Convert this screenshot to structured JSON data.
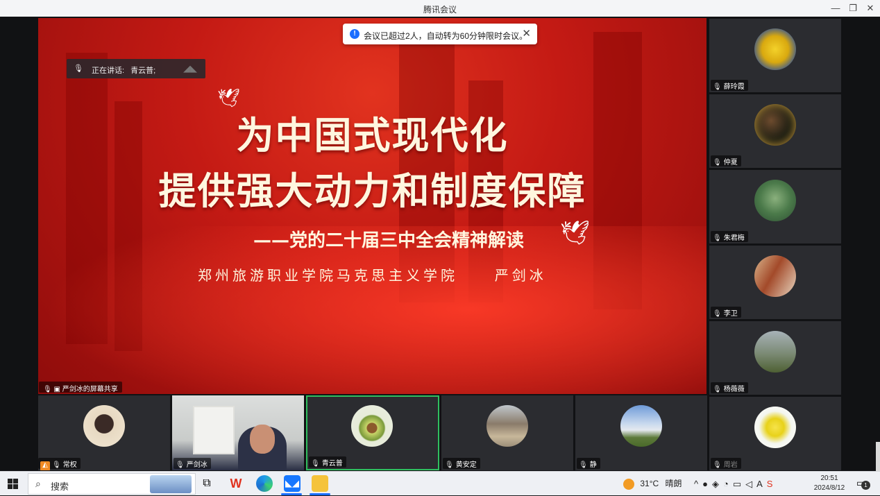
{
  "window": {
    "title": "腾讯会议"
  },
  "toast": {
    "message": "会议已超过2人，自动转为60分钟限时会议。",
    "close_icon": "close-icon",
    "info_icon": "info-icon"
  },
  "speaking": {
    "label": "正在讲话:",
    "speaker": "青云普;"
  },
  "slide": {
    "title_line1": "为中国式现代化",
    "title_line2": "提供强大动力和制度保障",
    "subtitle": "——党的二十届三中全会精神解读",
    "author_org": "郑州旅游职业学院马克思主义学院",
    "author_name": "严剑冰"
  },
  "screen_share_label": "严剑冰的屏幕共享",
  "side_participants": [
    {
      "name": "薛玲霞",
      "avatar": "yellow-flower"
    },
    {
      "name": "仲夏",
      "avatar": "lights"
    },
    {
      "name": "朱君梅",
      "avatar": "lotus-leaves"
    },
    {
      "name": "李卫",
      "avatar": "street-photo"
    },
    {
      "name": "杨薇薇",
      "avatar": "mountain-person"
    },
    {
      "name": "周岩",
      "avatar": "yellow-lily"
    }
  ],
  "bottom_participants": [
    {
      "name": "常权",
      "avatar": "cartoon-woman"
    },
    {
      "name": "严剑冰",
      "avatar": "camera-video"
    },
    {
      "name": "青云普",
      "avatar": "avocado"
    },
    {
      "name": "黄安定",
      "avatar": "building"
    },
    {
      "name": "静",
      "avatar": "sky-field"
    }
  ],
  "taskbar": {
    "search_label": "搜索",
    "weather_temp": "31°C",
    "weather_desc": "晴朗",
    "time": "20:51",
    "date": "2024/8/12",
    "notification_count": "1"
  },
  "colors": {
    "active_border": "#2fbf5f",
    "slide_red": "#c41a14",
    "title_cream": "#fff6df"
  }
}
